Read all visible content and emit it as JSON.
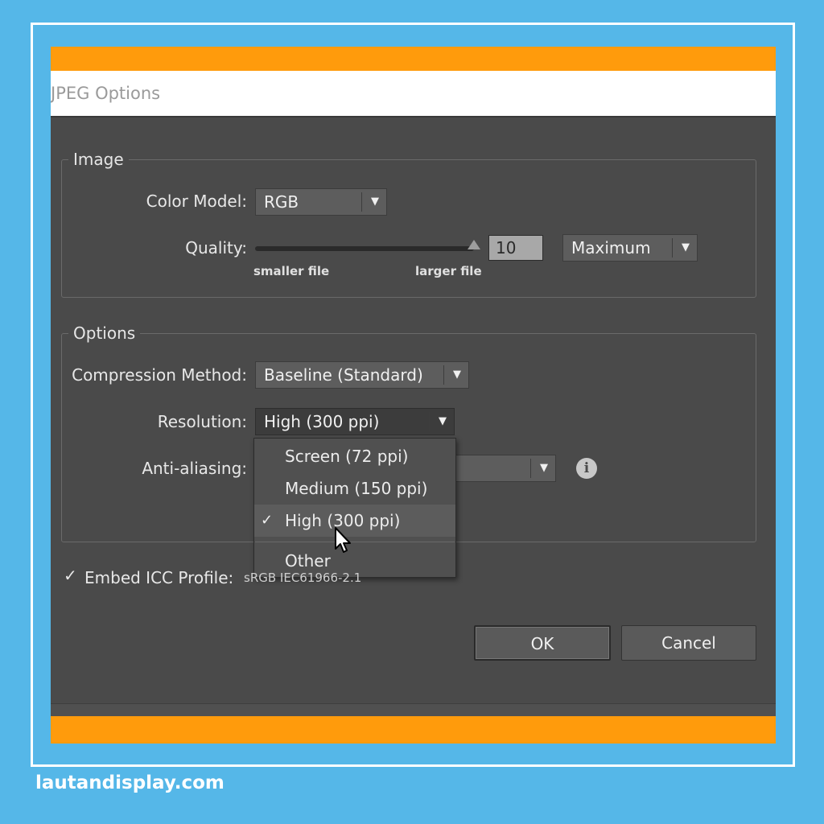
{
  "window": {
    "title": "JPEG Options"
  },
  "image_group": {
    "legend": "Image",
    "color_model_label": "Color Model:",
    "color_model_value": "RGB",
    "quality_label": "Quality:",
    "quality_value": "10",
    "quality_level": 1.0,
    "quality_preset": "Maximum",
    "smaller_file": "smaller file",
    "larger_file": "larger file"
  },
  "options_group": {
    "legend": "Options",
    "compression_label": "Compression Method:",
    "compression_value": "Baseline (Standard)",
    "resolution_label": "Resolution:",
    "resolution_value": "High (300 ppi)",
    "antialiasing_label": "Anti-aliasing:",
    "info_icon": "i"
  },
  "resolution_menu": {
    "items": [
      {
        "label": "Screen (72 ppi)",
        "checked": false
      },
      {
        "label": "Medium (150 ppi)",
        "checked": false
      },
      {
        "label": "High (300 ppi)",
        "checked": true
      },
      {
        "label": "Other",
        "checked": false
      }
    ],
    "check_glyph": "✓"
  },
  "icc": {
    "checked": true,
    "label": "Embed ICC Profile:",
    "value": "sRGB IEC61966-2.1"
  },
  "buttons": {
    "ok": "OK",
    "cancel": "Cancel"
  },
  "footer": {
    "site": "lautandisplay.com"
  },
  "colors": {
    "background": "#55b7e8",
    "accent": "#ff9b0c",
    "dialog": "#4a4a4a"
  }
}
